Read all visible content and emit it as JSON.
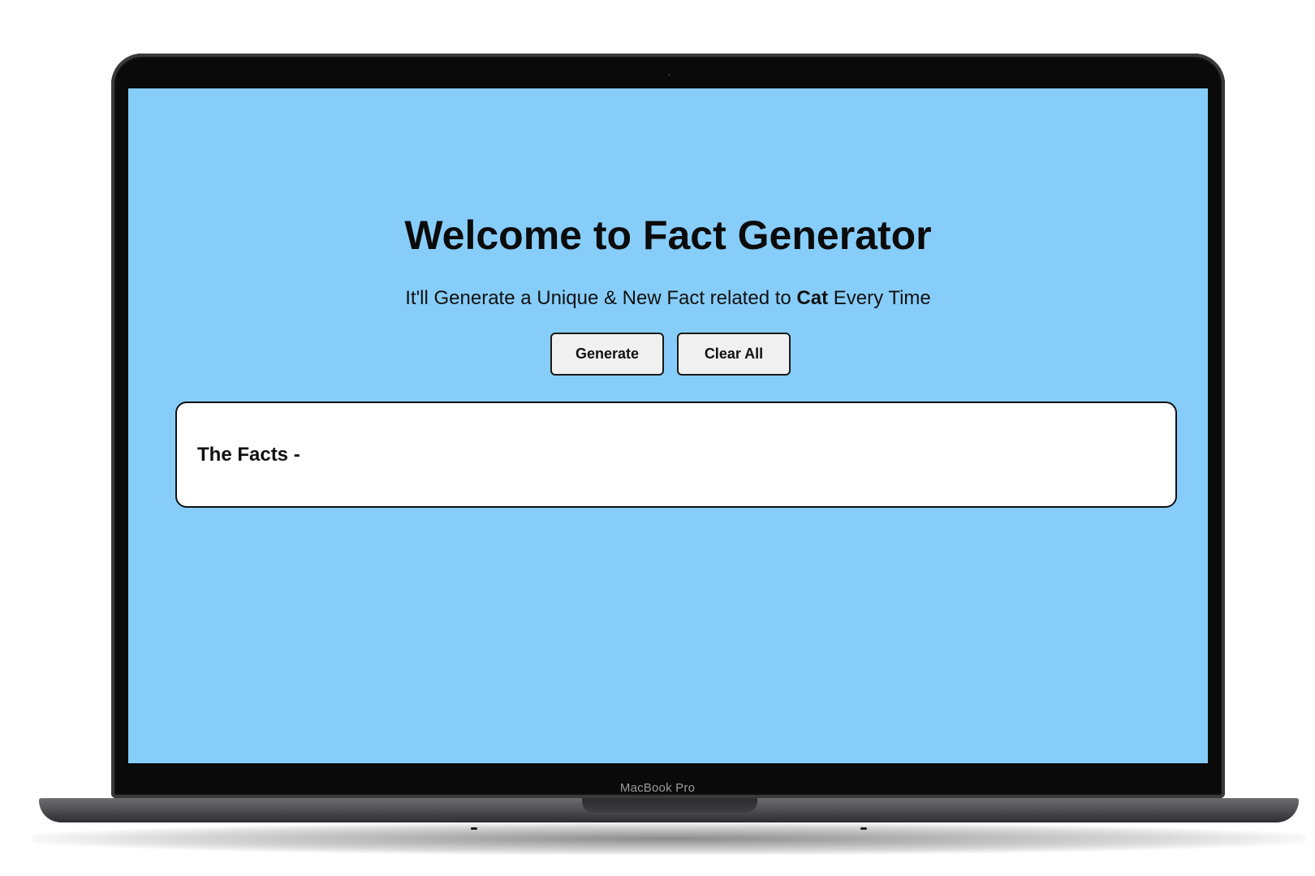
{
  "device": {
    "label": "MacBook Pro"
  },
  "app": {
    "background_color": "#87cdf9",
    "title": "Welcome to Fact Generator",
    "subtitle": {
      "prefix": "It'll Generate a Unique & New Fact related to ",
      "highlight": "Cat",
      "suffix": " Every Time"
    },
    "buttons": {
      "generate_label": "Generate",
      "clear_label": "Clear All"
    },
    "facts": {
      "heading": "The Facts -"
    }
  }
}
